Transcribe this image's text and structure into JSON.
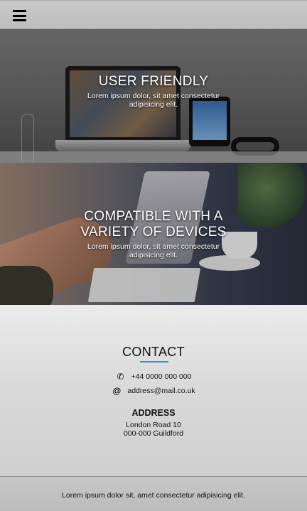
{
  "header": {
    "menu_icon": "hamburger-icon"
  },
  "hero_sections": [
    {
      "title": "USER FRIENDLY",
      "subtitle_line1": "Lorem ipsum dolor, sit amet consectetur",
      "subtitle_line2": "adipisicing elit."
    },
    {
      "title_line1": "COMPATIBLE WITH A",
      "title_line2": "VARIETY OF DEVICES",
      "subtitle_line1": "Lorem ipsum dolor, sit amet consectetur",
      "subtitle_line2": "adipisicing elit."
    }
  ],
  "contact": {
    "title": "CONTACT",
    "accent_color": "#2b97c7",
    "phone_icon": "phone-icon",
    "phone": "+44 0000 000 000",
    "email_icon": "at-sign-icon",
    "email": "address@mail.co.uk",
    "address_title": "ADDRESS",
    "address_line1": "London Road 10",
    "address_line2": "000-000 Guildford"
  },
  "footer": {
    "text": "Lorem ipsum dolor sit, amet consectetur adipisicing elit."
  }
}
